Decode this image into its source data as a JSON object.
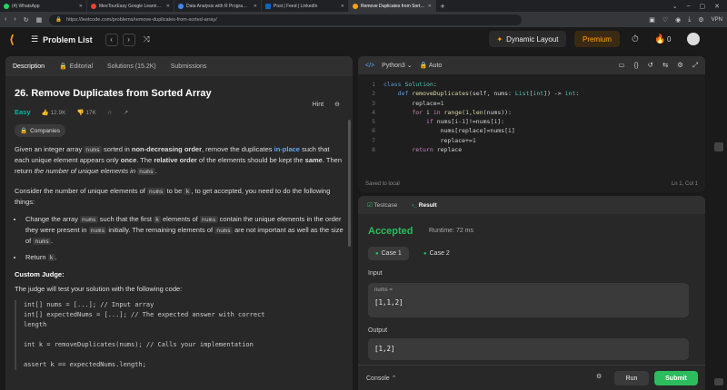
{
  "browser": {
    "tabs": [
      {
        "title": "(4) WhatsApp",
        "color": "#25d366"
      },
      {
        "title": "MeeTourEasy Google Learning Progr...",
        "color": "#ea4335"
      },
      {
        "title": "Data Analysis with R Programming - ...",
        "color": "#4285f4"
      },
      {
        "title": "Post | Feed | LinkedIn",
        "color": "#0a66c2"
      },
      {
        "title": "Remove Duplicates from Sorted ...",
        "color": "#ffa116",
        "active": true
      }
    ],
    "url": "https://leetcode.com/problems/remove-duplicates-from-sorted-array/",
    "vpn": "VPN"
  },
  "header": {
    "problem_list": "Problem List",
    "dynamic_layout": "Dynamic Layout",
    "premium": "Premium",
    "notifications": "0"
  },
  "left": {
    "tabs": [
      "Description",
      "Editorial",
      "Solutions (15.2K)",
      "Submissions"
    ],
    "title": "26. Remove Duplicates from Sorted Array",
    "hint": "Hint",
    "difficulty": "Easy",
    "likes": "12.9K",
    "dislikes": "17K",
    "companies": "Companies",
    "p1": {
      "a": "Given an integer array ",
      "c1": "nums",
      "b": " sorted in ",
      "bold1": "non-decreasing order",
      "c": ", remove the duplicates ",
      "blue": "in-place",
      "d": " such that each unique element appears only ",
      "bold2": "once",
      "e": ". The ",
      "bold3": "relative order",
      "f": " of the elements should be kept the ",
      "bold4": "same",
      "g": ". Then return ",
      "ital": "the number of unique elements in",
      "c2": "nums",
      "h": "."
    },
    "p2": {
      "a": "Consider the number of unique elements of ",
      "c1": "nums",
      "b": " to be ",
      "c2": "k",
      "c": ", to get accepted, you need to do the following things:"
    },
    "b1": {
      "a": "Change the array ",
      "c1": "nums",
      "b": " such that the first ",
      "c2": "k",
      "c": " elements of ",
      "c3": "nums",
      "d": " contain the unique elements in the order they were present in ",
      "c4": "nums",
      "e": " initially. The remaining elements of ",
      "c5": "nums",
      "f": " are not important as well as the size of ",
      "c6": "nums",
      "g": "."
    },
    "b2": {
      "a": "Return ",
      "c1": "k",
      "b": "."
    },
    "custom_judge": "Custom Judge:",
    "judge_text": "The judge will test your solution with the following code:",
    "code_lines": [
      "int[] nums = [...]; // Input array",
      "int[] expectedNums = [...]; // The expected answer with correct",
      "length",
      "",
      "int k = removeDuplicates(nums); // Calls your implementation",
      "",
      "assert k == expectedNums.length;"
    ]
  },
  "editor": {
    "language": "Python3",
    "mode": "Auto",
    "line_numbers": [
      "1",
      "2",
      "3",
      "4",
      "5",
      "6",
      "7",
      "8"
    ],
    "saved": "Saved to local",
    "cursor": "Ln 1, Col 1"
  },
  "result": {
    "tabs": [
      "Testcase",
      "Result"
    ],
    "status": "Accepted",
    "runtime": "Runtime: 72 ms",
    "cases": [
      "Case 1",
      "Case 2"
    ],
    "input_label": "Input",
    "input_var": "nums =",
    "input_value": "[1,1,2]",
    "output_label": "Output",
    "output_value": "[1,2]",
    "console": "Console",
    "run": "Run",
    "submit": "Submit"
  }
}
